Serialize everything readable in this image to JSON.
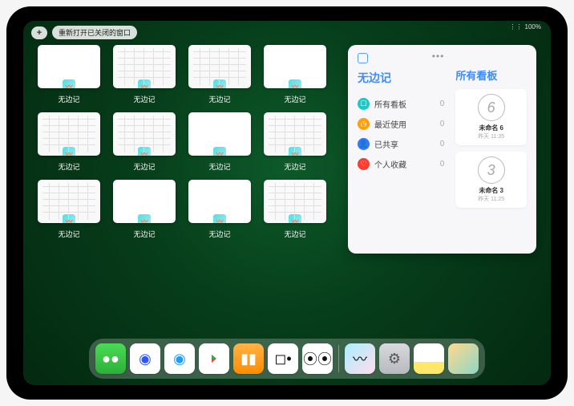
{
  "status": {
    "wifi": "⋮⋮",
    "battery": "100%"
  },
  "topbar": {
    "plus": "+",
    "reopen": "重新打开已关闭的窗口"
  },
  "app_label": "无边记",
  "window_variants": [
    "blank",
    "canvas",
    "canvas",
    "blank",
    "canvas",
    "canvas",
    "blank",
    "canvas",
    "canvas",
    "blank",
    "blank",
    "canvas"
  ],
  "panel": {
    "title": "无边记",
    "rows": [
      {
        "icon": "all",
        "glyph": "☐",
        "label": "所有看板",
        "count": "0"
      },
      {
        "icon": "recent",
        "glyph": "◷",
        "label": "最近使用",
        "count": "0"
      },
      {
        "icon": "shared",
        "glyph": "👤",
        "label": "已共享",
        "count": "0"
      },
      {
        "icon": "fav",
        "glyph": "♡",
        "label": "个人收藏",
        "count": "0"
      }
    ],
    "right_title": "所有看板",
    "boards": [
      {
        "glyph": "6",
        "name": "未命名 6",
        "date": "昨天 11:35"
      },
      {
        "glyph": "3",
        "name": "未命名 3",
        "date": "昨天 11:25"
      }
    ],
    "more": "•••"
  },
  "dock": {
    "wechat": "●●",
    "tb": "◉",
    "qq": "◉",
    "books": "▮▮",
    "cube": "◻•",
    "ctrl": "⦿⦿",
    "free": "〰",
    "settings": "⚙︎"
  }
}
